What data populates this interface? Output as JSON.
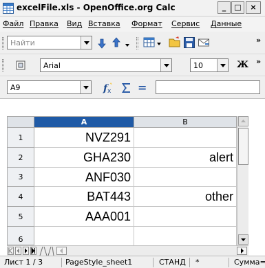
{
  "window": {
    "title": "excelFile.xls - OpenOffice.org Calc",
    "min_label": "_",
    "max_label": "□",
    "close_label": "×"
  },
  "menu": [
    "Файл",
    "Правка",
    "Вид",
    "Вставка",
    "Формат",
    "Сервис",
    "Данные"
  ],
  "find": {
    "placeholder": "Найти"
  },
  "font": {
    "name": "Arial",
    "size": "10",
    "bold_label": "Ж"
  },
  "formula": {
    "name_box": "A9",
    "value": "",
    "equals_label": "="
  },
  "sheet": {
    "columns": [
      "A",
      "B"
    ],
    "rows": [
      {
        "num": "1",
        "a": "NVZ291",
        "b": ""
      },
      {
        "num": "2",
        "a": "GHA230",
        "b": "alert"
      },
      {
        "num": "3",
        "a": "ANF030",
        "b": ""
      },
      {
        "num": "4",
        "a": "BAT443",
        "b": "other"
      },
      {
        "num": "5",
        "a": "AAA001",
        "b": ""
      },
      {
        "num": "6",
        "a": "",
        "b": ""
      }
    ]
  },
  "status": {
    "sheet": "Лист 1 / 3",
    "style": "PageStyle_sheet1",
    "mode": "СТАНД",
    "modified": "*",
    "sum": "Сумма="
  },
  "colors": {
    "selected_header": "#1f5aa6",
    "header": "#dfe3e8"
  }
}
